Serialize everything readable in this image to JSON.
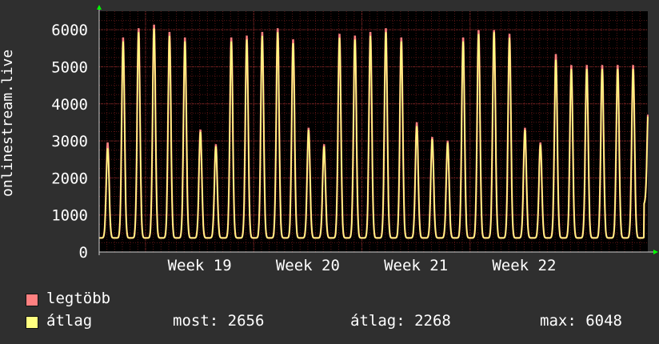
{
  "chart_data": {
    "type": "line",
    "ylabel": "onlinestream.live",
    "ylim": [
      0,
      6500
    ],
    "yticks": [
      0,
      1000,
      2000,
      3000,
      4000,
      5000,
      6000
    ],
    "x_unit": "day",
    "x_range_days": [
      0,
      35.5
    ],
    "x_tick_labels": [
      {
        "label": "Week 19",
        "day": 3.0
      },
      {
        "label": "Week 20",
        "day": 10.0
      },
      {
        "label": "Week 21",
        "day": 17.0
      },
      {
        "label": "Week 22",
        "day": 24.0
      }
    ],
    "grid": true,
    "colors": {
      "background": "#2f2f2f",
      "plot_bg": "#000000",
      "grid": "#5a1414",
      "axis": "#cfcfcf",
      "max_series": "#ff8080",
      "avg_series": "#ffff80",
      "arrow": "#00ff00"
    },
    "series": [
      {
        "name": "legtöbb",
        "color": "#ff8080",
        "daily_peaks": [
          2950,
          5800,
          6050,
          6150,
          5950,
          5800,
          3300,
          2900,
          5800,
          5850,
          5950,
          6050,
          5750,
          3350,
          2900,
          5900,
          5850,
          5950,
          6050,
          5800,
          3500,
          3100,
          3000,
          5800,
          6000,
          6000,
          5900,
          3350,
          2950,
          5350,
          5050
        ],
        "values": [
          2200,
          2950,
          5800,
          6050,
          6150,
          5950,
          5800,
          3300,
          2900,
          5800,
          5850,
          5950,
          6050,
          5750,
          3350,
          2900,
          5900,
          5850,
          5950,
          6050,
          5800,
          3500,
          3100,
          3000,
          5800,
          6000,
          6000,
          5900,
          3350,
          2950,
          5350,
          5050,
          2656
        ]
      },
      {
        "name": "átlag",
        "color": "#ffff80",
        "daily_peaks": [
          2800,
          5700,
          5950,
          6050,
          5850,
          5700,
          3250,
          2850,
          5700,
          5750,
          5850,
          5950,
          5650,
          3300,
          2850,
          5800,
          5750,
          5850,
          5950,
          5700,
          3400,
          3050,
          2950,
          5700,
          5900,
          5950,
          5800,
          3300,
          2900,
          5200,
          4950
        ],
        "values": [
          2100,
          2800,
          5700,
          5950,
          6050,
          5850,
          5700,
          3250,
          2850,
          5700,
          5750,
          5850,
          5950,
          5650,
          3300,
          2850,
          5800,
          5750,
          5850,
          5950,
          5700,
          3400,
          3050,
          2950,
          5700,
          5900,
          5950,
          5800,
          3300,
          2900,
          5200,
          4950,
          2656
        ]
      }
    ],
    "legend": [
      {
        "label": "legtöbb",
        "color": "#ff8080"
      },
      {
        "label": "átlag",
        "color": "#ffff80"
      }
    ],
    "stats": {
      "most": "most: 2656",
      "atlag": "átlag: 2268",
      "max": "max: 6048"
    }
  }
}
